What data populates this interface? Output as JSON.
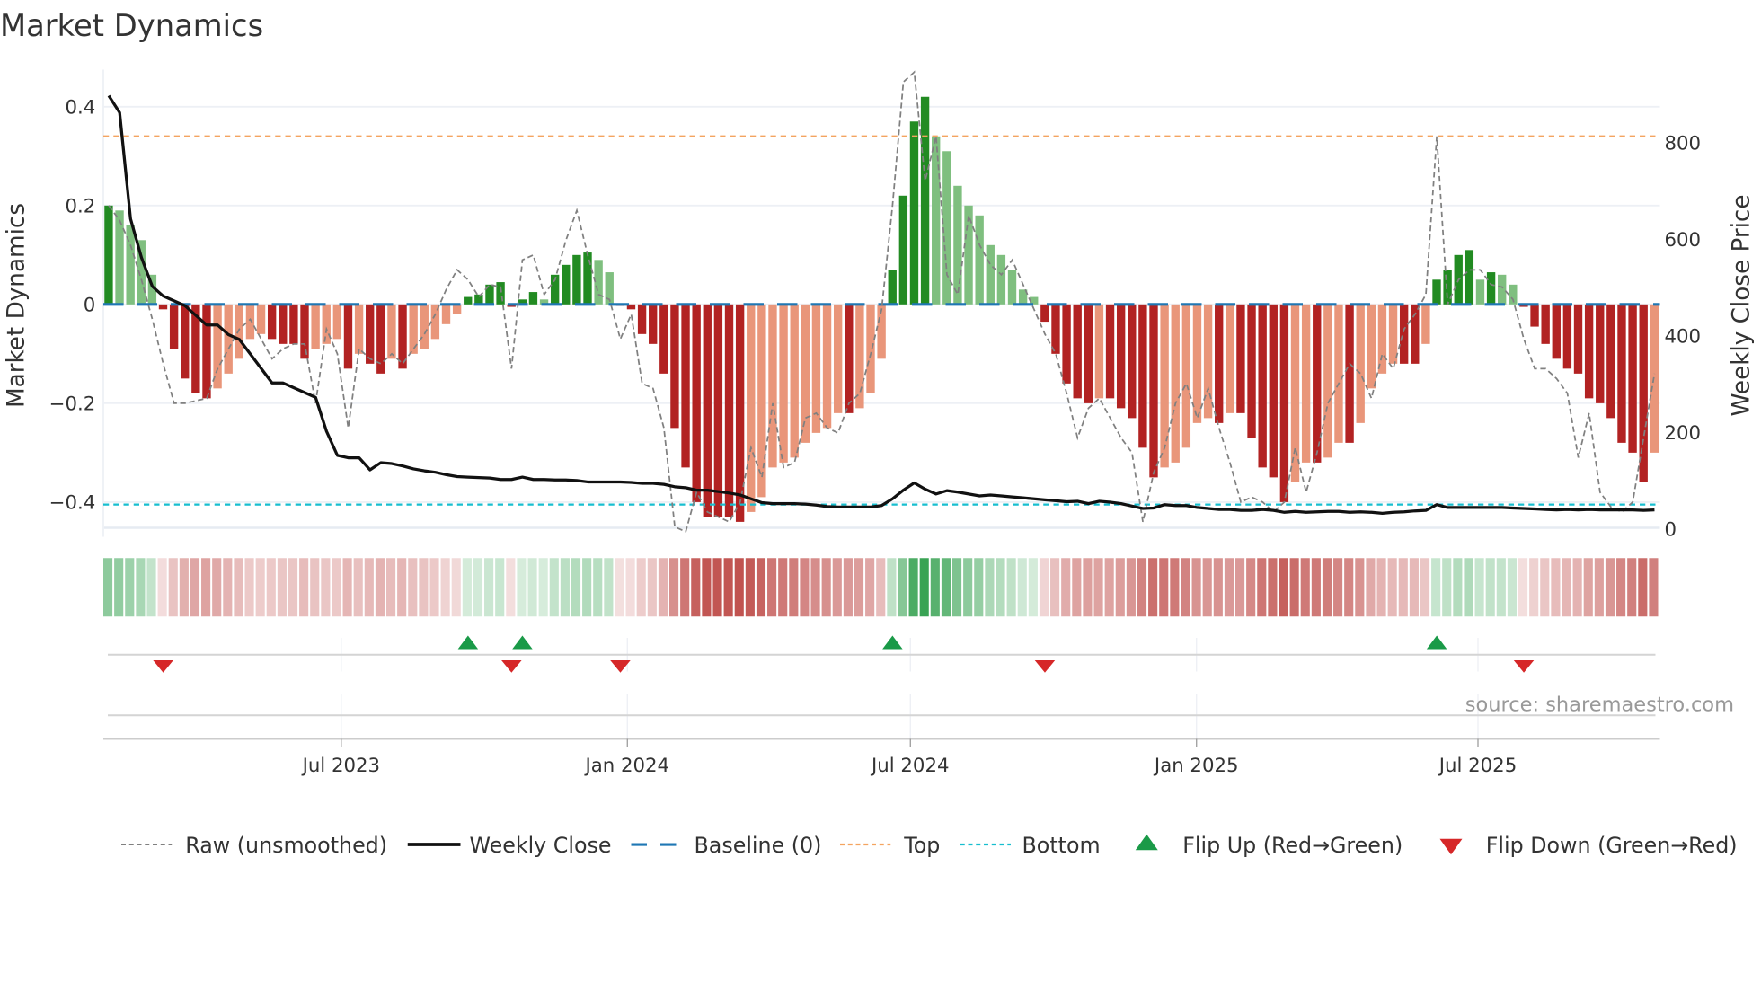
{
  "title": "Market Dynamics",
  "source": "source: sharemaestro.com",
  "colors": {
    "pos_strong": "#228b22",
    "pos_weak": "#7fbf7f",
    "neg_strong": "#b22222",
    "neg_weak": "#e9967a",
    "close": "#111111",
    "raw": "#808080",
    "baseline": "#1f77b4",
    "top": "#f4a460",
    "bottom": "#17becf",
    "flip_up": "#1a9a48",
    "flip_down": "#d62728",
    "heat_pos": "#2e9e4a",
    "heat_neg": "#c0504d"
  },
  "chart_data": {
    "type": "bar",
    "title": "Market Dynamics",
    "xlabel": "",
    "ylabel": "Market Dynamics",
    "y2label": "Weekly Close Price",
    "start_date": "2023-01-29",
    "frequency": "weekly",
    "ylim": [
      -0.452,
      0.475
    ],
    "y2lim": [
      0,
      949
    ],
    "yticks": [
      {
        "v": 0.4,
        "label": "0.4"
      },
      {
        "v": 0.2,
        "label": "0.2"
      },
      {
        "v": 0,
        "label": "0"
      },
      {
        "v": -0.2,
        "label": "−0.2"
      },
      {
        "v": -0.4,
        "label": "−0.4"
      }
    ],
    "y2ticks": [
      {
        "v": 0,
        "label": "0"
      },
      {
        "v": 200,
        "label": "200"
      },
      {
        "v": 400,
        "label": "400"
      },
      {
        "v": 600,
        "label": "600"
      },
      {
        "v": 800,
        "label": "800"
      }
    ],
    "xticks": [
      {
        "date": "2023-07-01",
        "label": "Jul 2023"
      },
      {
        "date": "2024-01-01",
        "label": "Jan 2024"
      },
      {
        "date": "2024-07-01",
        "label": "Jul 2024"
      },
      {
        "date": "2025-01-01",
        "label": "Jan 2025"
      },
      {
        "date": "2025-07-01",
        "label": "Jul 2025"
      }
    ],
    "top_level": 0.34,
    "bottom_level": -0.405,
    "baseline": 0,
    "grid": true,
    "legend_placement": "bottom",
    "series": [
      {
        "name": "Market Dynamics (smoothed)",
        "type": "bar",
        "values": [
          0.2,
          0.19,
          0.16,
          0.13,
          0.06,
          -0.01,
          -0.09,
          -0.15,
          -0.18,
          -0.19,
          -0.17,
          -0.14,
          -0.11,
          -0.07,
          -0.06,
          -0.07,
          -0.08,
          -0.08,
          -0.11,
          -0.09,
          -0.08,
          -0.07,
          -0.13,
          -0.1,
          -0.12,
          -0.14,
          -0.11,
          -0.13,
          -0.1,
          -0.09,
          -0.07,
          -0.04,
          -0.02,
          0.015,
          0.02,
          0.04,
          0.045,
          -0.005,
          0.01,
          0.025,
          0.01,
          0.06,
          0.08,
          0.1,
          0.105,
          0.09,
          0.065,
          -0.003,
          -0.01,
          -0.06,
          -0.08,
          -0.14,
          -0.25,
          -0.33,
          -0.4,
          -0.43,
          -0.43,
          -0.43,
          -0.44,
          -0.42,
          -0.39,
          -0.33,
          -0.32,
          -0.31,
          -0.28,
          -0.26,
          -0.25,
          -0.22,
          -0.22,
          -0.21,
          -0.18,
          -0.11,
          0.07,
          0.22,
          0.37,
          0.42,
          0.34,
          0.31,
          0.24,
          0.2,
          0.18,
          0.12,
          0.1,
          0.07,
          0.03,
          0.015,
          -0.035,
          -0.1,
          -0.16,
          -0.19,
          -0.2,
          -0.19,
          -0.19,
          -0.21,
          -0.23,
          -0.29,
          -0.35,
          -0.33,
          -0.32,
          -0.29,
          -0.24,
          -0.23,
          -0.24,
          -0.22,
          -0.22,
          -0.27,
          -0.33,
          -0.35,
          -0.4,
          -0.36,
          -0.32,
          -0.32,
          -0.31,
          -0.28,
          -0.28,
          -0.24,
          -0.17,
          -0.14,
          -0.12,
          -0.12,
          -0.12,
          -0.08,
          0.05,
          0.07,
          0.1,
          0.11,
          0.05,
          0.065,
          0.06,
          0.04,
          -0.005,
          -0.045,
          -0.08,
          -0.11,
          -0.13,
          -0.14,
          -0.19,
          -0.2,
          -0.23,
          -0.28,
          -0.3,
          -0.36,
          -0.3
        ]
      },
      {
        "name": "Raw (unsmoothed)",
        "type": "line",
        "values": [
          0.2,
          0.17,
          0.12,
          0.05,
          -0.03,
          -0.12,
          -0.2,
          -0.2,
          -0.195,
          -0.19,
          -0.13,
          -0.09,
          -0.05,
          -0.03,
          -0.07,
          -0.11,
          -0.09,
          -0.08,
          -0.08,
          -0.2,
          -0.05,
          -0.1,
          -0.25,
          -0.09,
          -0.11,
          -0.12,
          -0.1,
          -0.12,
          -0.09,
          -0.06,
          -0.02,
          0.03,
          0.07,
          0.05,
          0.015,
          0.04,
          0.035,
          -0.13,
          0.09,
          0.1,
          0.02,
          0.05,
          0.13,
          0.19,
          0.1,
          0.02,
          0.01,
          -0.07,
          -0.02,
          -0.16,
          -0.17,
          -0.25,
          -0.45,
          -0.46,
          -0.38,
          -0.42,
          -0.43,
          -0.44,
          -0.4,
          -0.29,
          -0.35,
          -0.2,
          -0.33,
          -0.32,
          -0.23,
          -0.22,
          -0.25,
          -0.26,
          -0.2,
          -0.18,
          -0.1,
          -0.01,
          0.2,
          0.45,
          0.47,
          0.25,
          0.34,
          0.06,
          0.02,
          0.18,
          0.12,
          0.08,
          0.06,
          0.09,
          0.04,
          -0.01,
          -0.06,
          -0.1,
          -0.18,
          -0.27,
          -0.21,
          -0.19,
          -0.23,
          -0.27,
          -0.3,
          -0.44,
          -0.34,
          -0.29,
          -0.2,
          -0.16,
          -0.23,
          -0.17,
          -0.25,
          -0.32,
          -0.4,
          -0.39,
          -0.4,
          -0.42,
          -0.4,
          -0.29,
          -0.38,
          -0.3,
          -0.2,
          -0.16,
          -0.12,
          -0.14,
          -0.19,
          -0.1,
          -0.13,
          -0.05,
          -0.02,
          0.02,
          0.34,
          0.0,
          0.05,
          0.07,
          0.07,
          0.04,
          0.035,
          0.01,
          -0.07,
          -0.13,
          -0.13,
          -0.15,
          -0.18,
          -0.31,
          -0.22,
          -0.38,
          -0.41,
          -0.42,
          -0.4,
          -0.27,
          -0.14
        ]
      },
      {
        "name": "Weekly Close",
        "type": "line",
        "axis": "right",
        "values": [
          895,
          860,
          640,
          560,
          500,
          480,
          470,
          460,
          440,
          420,
          420,
          400,
          390,
          360,
          330,
          300,
          300,
          290,
          280,
          270,
          200,
          150,
          145,
          145,
          120,
          135,
          133,
          128,
          122,
          118,
          115,
          110,
          106,
          105,
          104,
          103,
          100,
          100,
          105,
          100,
          100,
          99,
          99,
          98,
          95,
          95,
          95,
          95,
          94,
          92,
          92,
          90,
          85,
          83,
          78,
          78,
          75,
          72,
          68,
          60,
          52,
          50,
          50,
          50,
          49,
          47,
          44,
          43,
          43,
          43,
          43,
          46,
          60,
          78,
          93,
          80,
          70,
          77,
          74,
          70,
          66,
          68,
          66,
          64,
          62,
          60,
          58,
          56,
          54,
          55,
          50,
          55,
          53,
          50,
          45,
          40,
          41,
          48,
          46,
          46,
          42,
          40,
          38,
          38,
          36,
          36,
          38,
          36,
          32,
          34,
          32,
          33,
          34,
          34,
          32,
          33,
          32,
          30,
          32,
          33,
          35,
          36,
          48,
          42,
          42,
          42,
          42,
          42,
          42,
          41,
          40,
          39,
          38,
          37,
          38,
          37,
          38,
          37,
          37,
          37,
          37,
          36,
          37
        ]
      }
    ],
    "flips_up_weeks": [
      33,
      38,
      72,
      122
    ],
    "flips_down_weeks": [
      5,
      37,
      47,
      86,
      130
    ]
  },
  "legend": [
    {
      "key": "raw",
      "label": "Raw (unsmoothed)"
    },
    {
      "key": "close",
      "label": "Weekly Close"
    },
    {
      "key": "baseline",
      "label": "Baseline (0)"
    },
    {
      "key": "top",
      "label": "Top"
    },
    {
      "key": "bottom",
      "label": "Bottom"
    },
    {
      "key": "flip_up",
      "label": "Flip Up (Red→Green)"
    },
    {
      "key": "flip_down",
      "label": "Flip Down (Green→Red)"
    }
  ]
}
